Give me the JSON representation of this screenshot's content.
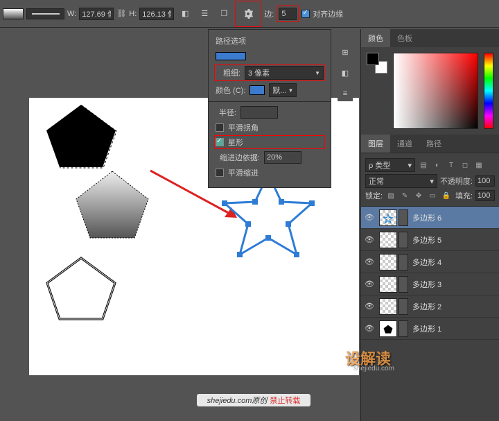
{
  "topbar": {
    "w_label": "W:",
    "w_value": "127.69 像",
    "h_label": "H:",
    "h_value": "126.13 像",
    "sides_label": "边:",
    "sides_value": "5",
    "align_edges": "对齐边缘"
  },
  "popup": {
    "title": "路径选项",
    "thickness_label": "粗细:",
    "thickness_value": "3 像素",
    "color_label": "颜色 (C):",
    "color_value": "默...",
    "radius_label": "半径:",
    "radius_value": "",
    "smooth_corner": "平滑拐角",
    "star": "星形",
    "indent_label": "缩进边依据:",
    "indent_value": "20%",
    "smooth_indent": "平滑缩进"
  },
  "panels": {
    "color_tab": "颜色",
    "swatches_tab": "色板",
    "layers_tab": "图层",
    "channels_tab": "通道",
    "paths_tab": "路径"
  },
  "layer_controls": {
    "kind_prefix": "ρ",
    "kind_label": "类型",
    "blend_mode": "正常",
    "opacity_label": "不透明度:",
    "opacity_value": "100",
    "lock_label": "锁定:",
    "fill_label": "填充:",
    "fill_value": "100"
  },
  "layers": [
    {
      "name": "多边形 6",
      "active": true
    },
    {
      "name": "多边形 5",
      "active": false
    },
    {
      "name": "多边形 4",
      "active": false
    },
    {
      "name": "多边形 3",
      "active": false
    },
    {
      "name": "多边形 2",
      "active": false
    },
    {
      "name": "多边形 1",
      "active": false
    }
  ],
  "watermark": {
    "main": "设解读",
    "sub": "shejiedu.com"
  },
  "footer": {
    "text": "shejiedu.com原创",
    "ban": "禁止转载"
  }
}
